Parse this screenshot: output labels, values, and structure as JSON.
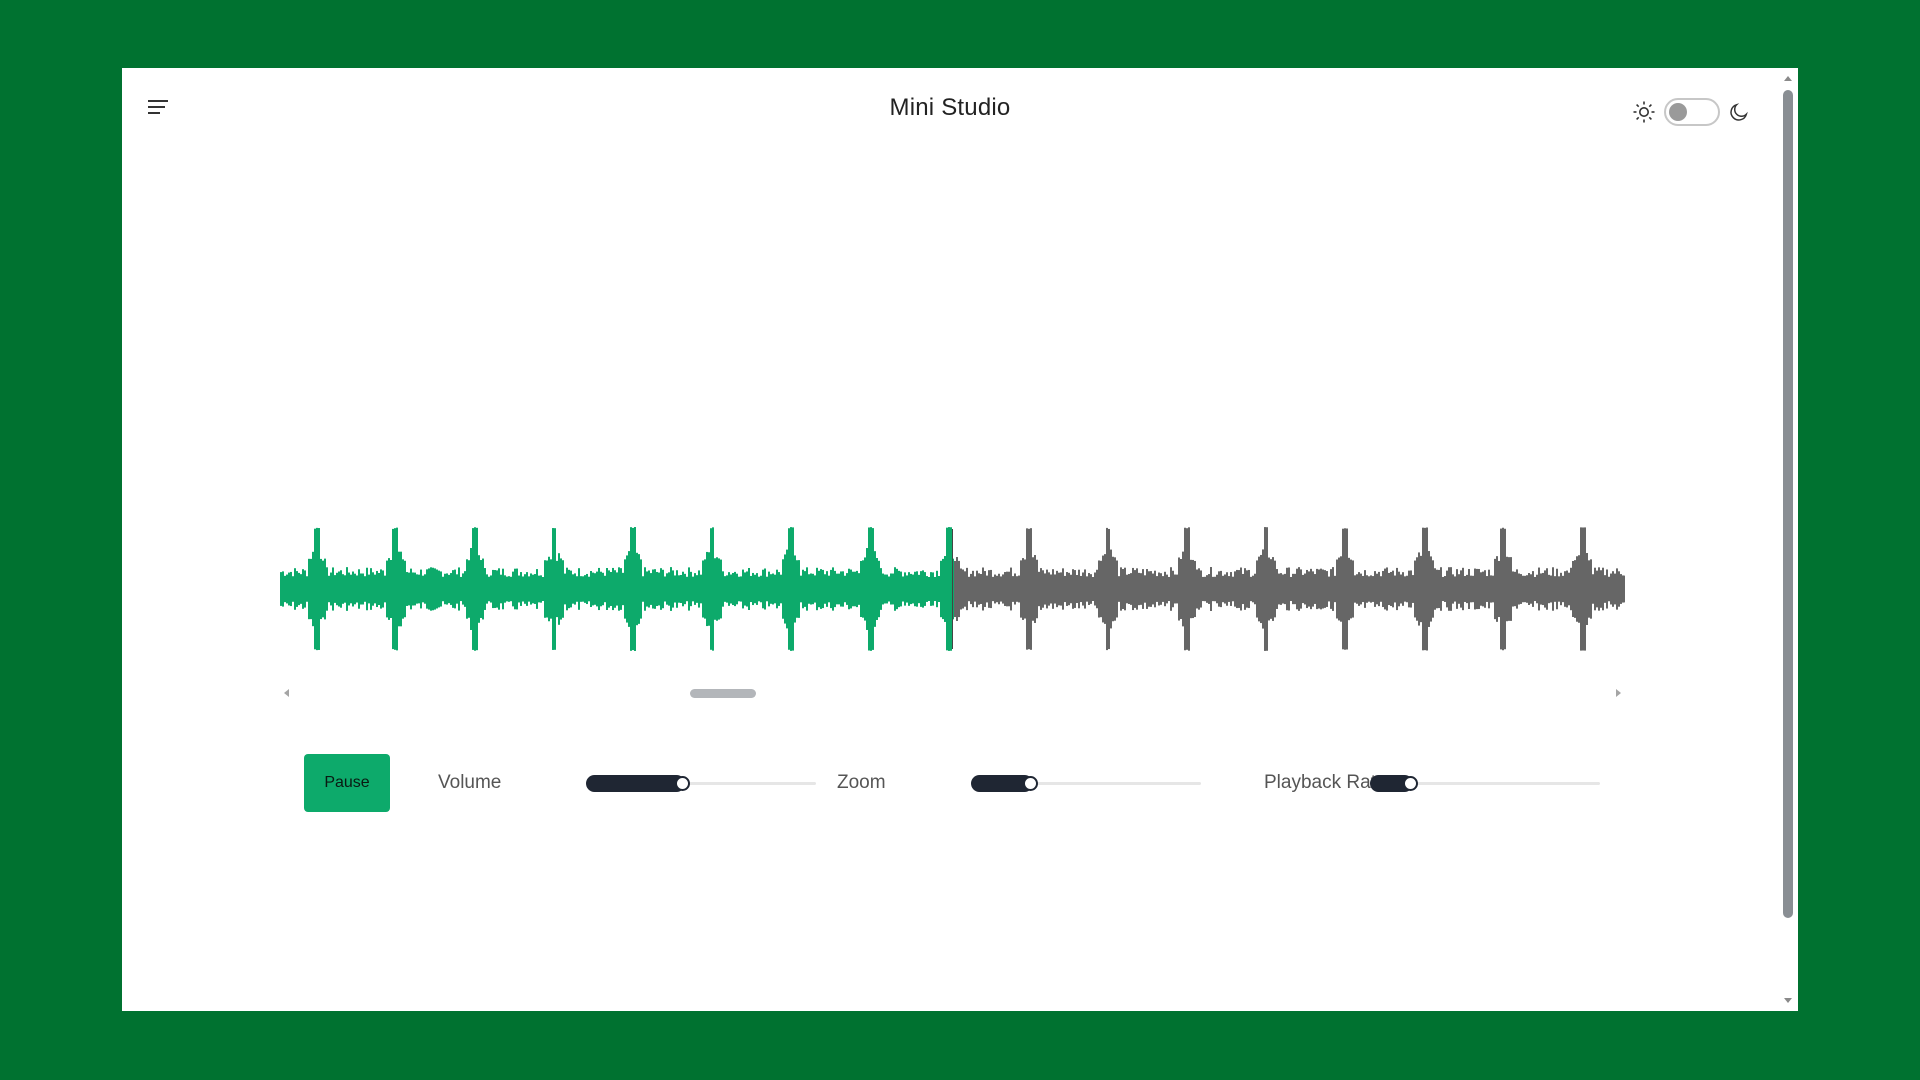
{
  "app": {
    "title": "Mini Studio"
  },
  "header": {
    "menu_icon": "hamburger-menu-icon",
    "theme": {
      "light_icon": "sun-icon",
      "dark_icon": "moon-icon",
      "dark_mode_enabled": false
    }
  },
  "waveform": {
    "played_color": "#0daa6b",
    "unplayed_color": "#666666",
    "progress_fraction": 0.5,
    "beat_count": 17
  },
  "controls": {
    "pause_label": "Pause",
    "volume": {
      "label": "Volume",
      "value": 0.42
    },
    "zoom": {
      "label": "Zoom",
      "value": 0.26
    },
    "playback_rate": {
      "label": "Playback Rate",
      "value": 0.18
    }
  },
  "colors": {
    "background": "#007230",
    "accent": "#0daa6b",
    "slider_fill": "#1f2633"
  }
}
